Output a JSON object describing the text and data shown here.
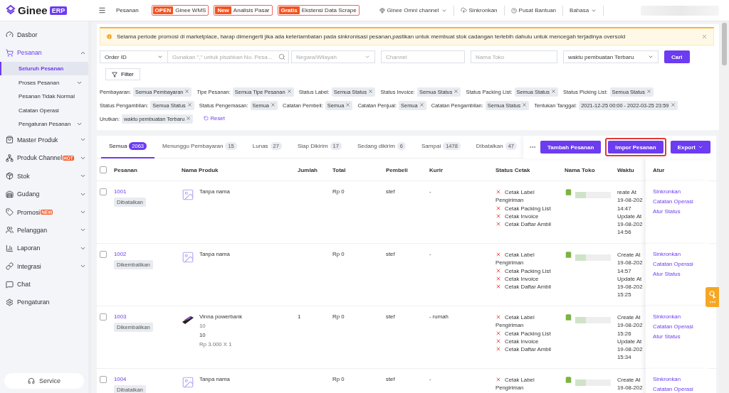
{
  "header": {
    "logo": "Ginee",
    "logo_badge": "ERP",
    "breadcrumb": "Pesanan",
    "promos": [
      {
        "badge": "OPEN",
        "label": "Ginee WMS"
      },
      {
        "badge": "New",
        "label": "Analisis Pasar"
      },
      {
        "badge": "Gratis",
        "label": "Ekstensi Data Scrape"
      }
    ],
    "links": [
      {
        "label": "Ginee Omni channel",
        "kind": "omni"
      },
      {
        "label": "Sinkronkan",
        "kind": "sync"
      },
      {
        "label": "Pusat Bantuan",
        "kind": "help"
      },
      {
        "label": "Bahasa",
        "kind": "language"
      }
    ]
  },
  "sidebar": {
    "items": [
      {
        "label": "Dasbor",
        "kind": "link",
        "selected": false
      },
      {
        "label": "Pesanan",
        "kind": "group",
        "expanded": true,
        "selected": true,
        "children": [
          {
            "label": "Seluruh Pesanan",
            "selected": true,
            "kind": "link"
          },
          {
            "label": "Proses Pesanan",
            "selected": false,
            "kind": "group"
          },
          {
            "label": "Pesanan Tidak Normal",
            "selected": false,
            "kind": "link"
          },
          {
            "label": "Catatan Operasi",
            "selected": false,
            "kind": "link"
          },
          {
            "label": "Pengaturan Pesanan",
            "selected": false,
            "kind": "group"
          }
        ]
      },
      {
        "label": "Master Produk",
        "kind": "group",
        "expanded": false,
        "selected": false
      },
      {
        "label": "Produk Channel",
        "kind": "group",
        "expanded": false,
        "selected": false,
        "badge": "HOT"
      },
      {
        "label": "Stok",
        "kind": "group",
        "expanded": false,
        "selected": false
      },
      {
        "label": "Gudang",
        "kind": "group",
        "expanded": false,
        "selected": false
      },
      {
        "label": "Promosi",
        "kind": "group",
        "expanded": false,
        "selected": false,
        "badge": "NEW"
      },
      {
        "label": "Pelanggan",
        "kind": "group",
        "expanded": false,
        "selected": false
      },
      {
        "label": "Laporan",
        "kind": "group",
        "expanded": false,
        "selected": false
      },
      {
        "label": "Integrasi",
        "kind": "group",
        "expanded": false,
        "selected": false
      },
      {
        "label": "Chat",
        "kind": "link",
        "selected": false
      },
      {
        "label": "Pengaturan",
        "kind": "link",
        "selected": false
      }
    ],
    "service": "Service"
  },
  "alert": {
    "text": "Selama periode promosi di marketplace, harap dimengerti jika ada keterlambatan pada sinkronisasi pesanan,pastikan untuk membuat stok cadangan terlebih dahulu untuk mencegah terjadinya oversold"
  },
  "filters": {
    "field_select": "Order ID",
    "search_placeholder": "Gunakan \",\" untuk pisahkan No. Pesa...",
    "region_placeholder": "Negara/Wilayah",
    "channel_placeholder": "Channel",
    "store_placeholder": "Nama Toko",
    "sort_value": "waktu pembuatan Terbaru",
    "search_button": "Cari",
    "filter_button": "Filter",
    "chips": [
      {
        "label": "Pembayaran:",
        "value": "Semua Pembayaran"
      },
      {
        "label": "Tipe Pesanan:",
        "value": "Semua Tipe Pesanan"
      },
      {
        "label": "Status Label:",
        "value": "Semua Status"
      },
      {
        "label": "Status Invoice:",
        "value": "Semua Status"
      },
      {
        "label": "Status Packing List:",
        "value": "Semua Status"
      },
      {
        "label": "Status Picking List:",
        "value": "Semua Status"
      },
      {
        "label": "Status Pengambilan:",
        "value": "Semua Status"
      },
      {
        "label": "Status Pengemasan:",
        "value": "Semua"
      },
      {
        "label": "Catatan Pembeli:",
        "value": "Semua"
      },
      {
        "label": "Catatan Penjual:",
        "value": "Semua"
      },
      {
        "label": "Catatan Pengambilan:",
        "value": "Semua Status"
      },
      {
        "label": "Tentukan Tanggal:",
        "value": "2021-12-25 00:00 - 2022-03-25 23:59"
      },
      {
        "label": "Urutkan:",
        "value": "waktu pembuatan Terbaru"
      }
    ],
    "reset": "Reset"
  },
  "tabs": [
    {
      "label": "Semua",
      "count": "2063",
      "selected": true
    },
    {
      "label": "Menunggu Pembayaran",
      "count": "15",
      "selected": false
    },
    {
      "label": "Lunas",
      "count": "27",
      "selected": false
    },
    {
      "label": "Siap Dikirim",
      "count": "17",
      "selected": false
    },
    {
      "label": "Sedang dikirim",
      "count": "6",
      "selected": false
    },
    {
      "label": "Sampai",
      "count": "1478",
      "selected": false
    },
    {
      "label": "Dibatalkan",
      "count": "47",
      "selected": false
    }
  ],
  "toolbar": [
    {
      "label": "Tambah Pesanan",
      "kind": "primary",
      "highlighted": false
    },
    {
      "label": "Impor Pesanan",
      "kind": "primary",
      "highlighted": true
    },
    {
      "label": "Export",
      "kind": "dropdown",
      "highlighted": false
    }
  ],
  "table": {
    "select_all": false,
    "columns": [
      "Pesanan",
      "Nama Produk",
      "Jumlah",
      "Total",
      "Pembeli",
      "Kurir",
      "Status Cetak",
      "Nama Toko",
      "Waktu",
      "Atur"
    ],
    "rows": [
      {
        "order": "1001",
        "status": "Dibatalkan",
        "checked": false,
        "product": {
          "kind": "placeholder",
          "name": "Tanpa nama"
        },
        "total": "Rp 0",
        "buyer": "stef",
        "courier": "-",
        "print": [
          {
            "label": "Cetak Label Pengiriman",
            "done": false
          },
          {
            "label": "Cetak Packing List",
            "done": false
          },
          {
            "label": "Cetak Invoice",
            "done": false
          },
          {
            "label": "Cetak Daftar Ambil",
            "done": false
          }
        ],
        "times": [
          "reate At",
          "19-08-202",
          "14:47",
          "Update At",
          "19-08-202",
          "14:56"
        ],
        "actions": [
          "Sinkronkan",
          "Catatan Operasi",
          "Atur Status"
        ]
      },
      {
        "order": "1002",
        "status": "Dikembalikan",
        "checked": false,
        "product": {
          "kind": "placeholder",
          "name": "Tanpa nama"
        },
        "total": "Rp 0",
        "buyer": "stef",
        "courier": "-",
        "print": [
          {
            "label": "Cetak Label Pengiriman",
            "done": false
          },
          {
            "label": "Cetak Packing List",
            "done": false
          },
          {
            "label": "Cetak Invoice",
            "done": false
          },
          {
            "label": "Cetak Daftar Ambil",
            "done": false
          }
        ],
        "times": [
          "Create At",
          "19-08-202",
          "14:57",
          "Update At",
          "19-08-202",
          "15:25"
        ],
        "actions": [
          "Sinkronkan",
          "Catatan Operasi",
          "Atur Status"
        ]
      },
      {
        "order": "1003",
        "status": "Dikembalikan",
        "checked": false,
        "product": {
          "name": "Vinna powerbank",
          "lines": [
            {
              "text": "10",
              "kind": "muted"
            },
            {
              "text": "10",
              "kind": "plain"
            },
            {
              "text": "Rp 3.000 X 1",
              "kind": "muted"
            }
          ]
        },
        "qty": "1",
        "total": "Rp 0",
        "buyer": "stef",
        "courier": "- rumah",
        "print": [
          {
            "label": "Cetak Label Pengiriman",
            "done": false
          },
          {
            "label": "Cetak Packing List",
            "done": false
          },
          {
            "label": "Cetak Invoice",
            "done": false
          },
          {
            "label": "Cetak Daftar Ambil",
            "done": false
          }
        ],
        "times": [
          "Create At",
          "19-08-202",
          "15:26",
          "Update At",
          "19-08-202",
          "15:34"
        ],
        "actions": [
          "Sinkronkan",
          "Catatan Operasi",
          "Atur Status"
        ]
      },
      {
        "order": "1004",
        "status": "Dibatalkan",
        "checked": false,
        "product": {
          "kind": "placeholder",
          "name": "Tanpa nama"
        },
        "total": "Rp 0",
        "buyer": "stef",
        "courier": "-",
        "print": [
          {
            "label": "Cetak Label Pengiriman",
            "done": false
          }
        ],
        "times": [
          "Create At",
          "19-08-202"
        ],
        "actions": [
          "Sinkronkan",
          "Catatan Operasi"
        ]
      }
    ]
  }
}
